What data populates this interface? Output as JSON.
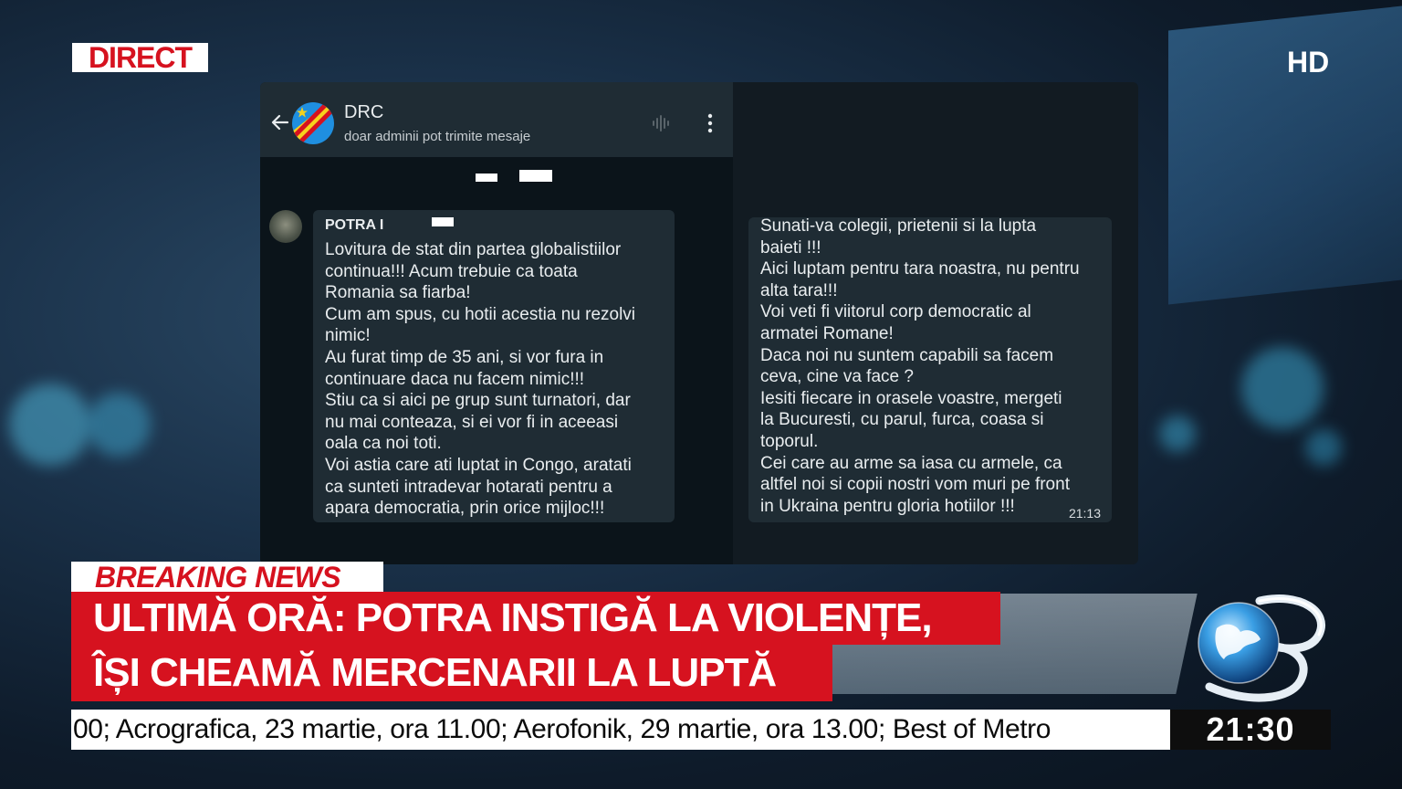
{
  "badges": {
    "live": "DIRECT",
    "quality": "HD"
  },
  "chat": {
    "title": "DRC",
    "subtitle": "doar adminii pot trimite mesaje",
    "sender": "POTRA I",
    "message_left": "Lovitura de stat din partea globalistiilor\ncontinua!!! Acum trebuie ca toata\nRomania sa fiarba!\nCum am spus, cu hotii acestia nu rezolvi\nnimic!\nAu furat timp de 35 ani, si vor fura in\ncontinuare daca nu facem nimic!!!\nStiu ca si aici pe grup sunt turnatori, dar\nnu mai conteaza, si ei vor fi in aceeasi\noala ca noi toti.\nVoi astia care ati luptat in Congo, aratati\nca sunteti intradevar hotarati pentru a\napara democratia, prin orice mijloc!!!",
    "message_right": "Sunati-va colegii, prietenii si la lupta\nbaieti !!!\nAici luptam pentru tara noastra, nu pentru\nalta tara!!!\nVoi veti fi viitorul corp democratic al\narmatei Romane!\nDaca noi nu suntem capabili sa facem\nceva, cine va face ?\nIesiti fiecare in orasele voastre, mergeti\nla Bucuresti, cu parul, furca, coasa si\ntoporul.\nCei care au arme sa iasa cu armele, ca\naltfel noi si copii nostri vom muri pe front\nin Ukraina pentru gloria hotiilor !!!",
    "time": "21:13"
  },
  "news": {
    "breaking_label": "BREAKING NEWS",
    "headline_line1": "ULTIMĂ ORĂ: POTRA INSTIGĂ LA VIOLENȚE,",
    "headline_line2": "ÎȘI CHEAMĂ MERCENARII LA LUPTĂ",
    "ticker": "00; Acrografica, 23 martie, ora 11.00; Aerofonik, 29 martie, ora 13.00; Best of Metro",
    "clock": "21:30"
  },
  "icons": [
    "back-arrow-icon",
    "drc-flag-icon",
    "audio-wave-icon",
    "more-vertical-icon",
    "globe-channel-logo"
  ],
  "colors": {
    "accent_red": "#d6121f",
    "chat_bubble": "#1f2c34",
    "chat_bg": "#0b141a"
  }
}
